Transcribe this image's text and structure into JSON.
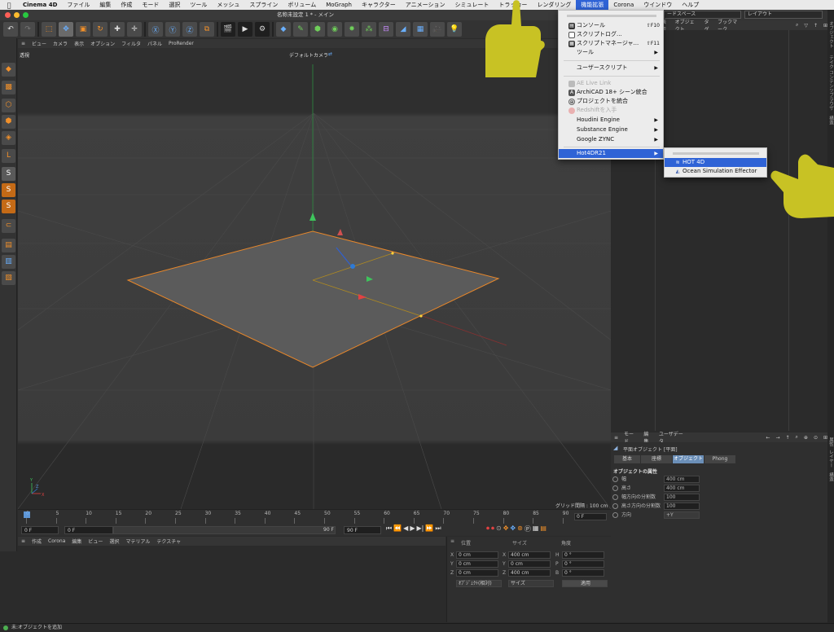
{
  "menubar": {
    "items": [
      "Cinema 4D",
      "ファイル",
      "編集",
      "作成",
      "モード",
      "選択",
      "ツール",
      "メッシュ",
      "スプライン",
      "ボリューム",
      "MoGraph",
      "キャラクター",
      "アニメーション",
      "シミュレート",
      "トラッカー",
      "レンダリング",
      "機能拡張",
      "Corona",
      "ウインドウ",
      "ヘルプ"
    ],
    "active_index": 16
  },
  "window": {
    "title": "名称未設定 1 * - メイン"
  },
  "viewport": {
    "menu": [
      "ビュー",
      "カメラ",
      "表示",
      "オプション",
      "フィルタ",
      "パネル",
      "ProRender"
    ],
    "projection": "透視",
    "camera": "デフォルトカメラ",
    "grid_info": "グリッド間隔 : 100 cm"
  },
  "timeline": {
    "ticks": [
      "0",
      "5",
      "10",
      "15",
      "20",
      "25",
      "30",
      "35",
      "40",
      "45",
      "50",
      "55",
      "60",
      "65",
      "70",
      "75",
      "80",
      "85",
      "90"
    ],
    "end_frame": "0 F",
    "start_field": "0 F",
    "current_field": "0 F",
    "max_field": "90 F",
    "end_field": "90 F"
  },
  "material": {
    "menu": [
      "作成",
      "Corona",
      "編集",
      "ビュー",
      "選択",
      "マテリアル",
      "テクスチャ"
    ]
  },
  "coord": {
    "headers": [
      "位置",
      "サイズ",
      "角度"
    ],
    "rows": [
      {
        "a": "X",
        "pos": "0 cm",
        "b": "X",
        "size": "400 cm",
        "c": "H",
        "rot": "0 °"
      },
      {
        "a": "Y",
        "pos": "0 cm",
        "b": "Y",
        "size": "0 cm",
        "c": "P",
        "rot": "0 °"
      },
      {
        "a": "Z",
        "pos": "0 cm",
        "b": "Z",
        "size": "400 cm",
        "c": "B",
        "rot": "0 °"
      }
    ],
    "mode_select": "ｵﾌﾞｼﾞｪｸﾄ(相対)",
    "size_select": "サイズ",
    "apply": "適用"
  },
  "object_manager": {
    "layout_left": "ードスペース",
    "layout_right": "レイアウト",
    "menu": [
      "表示",
      "オブジェクト",
      "タグ",
      "ブックマーク"
    ]
  },
  "attribute_manager": {
    "menu": [
      "モード",
      "編集",
      "ユーザデータ"
    ],
    "object_name": "平面オブジェクト [平面]",
    "tabs": [
      "基本",
      "座標",
      "オブジェクト",
      "Phong"
    ],
    "active_tab": 2,
    "section": "オブジェクトの属性",
    "props": [
      {
        "label": "幅",
        "value": "400 cm"
      },
      {
        "label": "高さ",
        "value": "400 cm"
      },
      {
        "label": "幅方向の分割数",
        "value": "100"
      },
      {
        "label": "高さ方向の分割数",
        "value": "100"
      },
      {
        "label": "方向",
        "value": "+Y"
      }
    ]
  },
  "right_strip": {
    "tabs": [
      "オブジェクト",
      "テイク",
      "コンテンツブラウザ",
      "構造",
      "属性",
      "レイヤー",
      "構造"
    ]
  },
  "plugins_menu": {
    "items": [
      {
        "label": "コンソール",
        "shortcut": "⇧F10",
        "icon": "console-icon"
      },
      {
        "label": "スクリプトログ...",
        "shortcut": "",
        "icon": "script-log-icon"
      },
      {
        "label": "スクリプトマネージャ...",
        "shortcut": "⇧F11",
        "icon": "script-manager-icon"
      },
      {
        "label": "ツール",
        "submenu": true
      },
      {
        "label": "ユーザースクリプト",
        "submenu": true
      },
      {
        "label": "AE Live Link",
        "disabled": true,
        "icon": "ae-icon"
      },
      {
        "label": "ArchiCAD 18+ シーン統合",
        "icon": "archicad-icon"
      },
      {
        "label": "プロジェクトを統合",
        "icon": "merge-icon"
      },
      {
        "label": "Redshiftを入手",
        "disabled": true,
        "icon": "redshift-icon"
      },
      {
        "label": "Houdini Engine",
        "submenu": true
      },
      {
        "label": "Substance Engine",
        "submenu": true
      },
      {
        "label": "Google ZYNC",
        "submenu": true
      },
      {
        "label": "Hot4DR21",
        "submenu": true,
        "highlighted": true
      }
    ]
  },
  "submenu": {
    "items": [
      {
        "label": "HOT 4D",
        "highlighted": true
      },
      {
        "label": "Ocean Simulation Effector"
      }
    ]
  },
  "status": {
    "text": "未:オブジェクトを追加"
  },
  "colors": {
    "accent": "#2f63d6",
    "selection_orange": "#f1902a",
    "hand": "#c8c224"
  }
}
